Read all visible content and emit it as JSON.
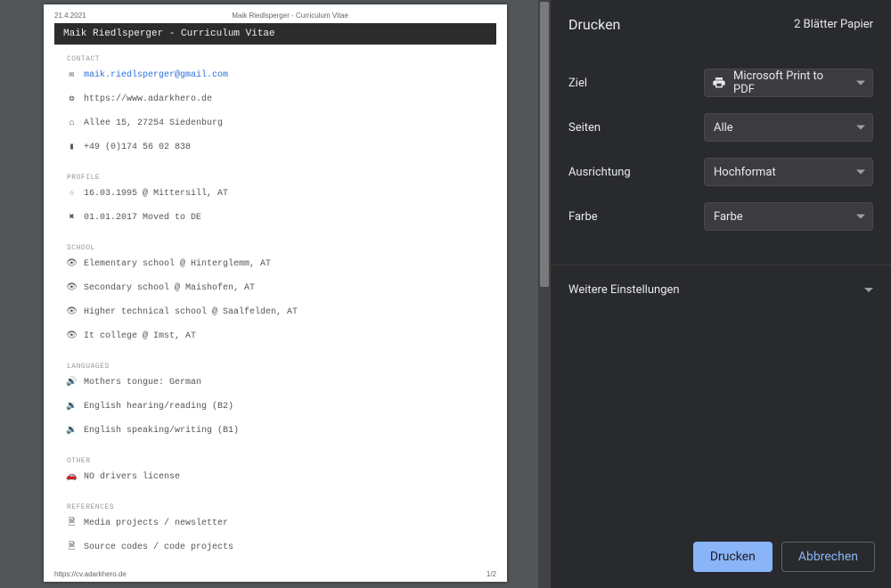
{
  "preview": {
    "date": "21.4.2021",
    "headerTitle": "Maik Riedlsperger - Curriculum Vitae",
    "pageTitle": "Maik Riedlsperger - Curriculum Vitae",
    "footerUrl": "https://cv.adarkhero.de",
    "pageIndicator": "1/2",
    "sections": {
      "contact": {
        "label": "CONTACT",
        "email": "maik.riedlsperger@gmail.com",
        "website": "https://www.adarkhero.de",
        "address": "Allee 15, 27254 Siedenburg",
        "phone": "+49 (0)174 56 02 838"
      },
      "profile": {
        "label": "PROFILE",
        "birth": "16.03.1995 @ Mittersill, AT",
        "moved": "01.01.2017 Moved to DE"
      },
      "school": {
        "label": "SCHOOL",
        "s1": "Elementary school @ Hinterglemm, AT",
        "s2": "Secondary school @ Maishofen, AT",
        "s3": "Higher technical school @ Saalfelden, AT",
        "s4": "It college @ Imst, AT"
      },
      "languages": {
        "label": "LANGUAGES",
        "l1": "Mothers tongue: German",
        "l2": "English hearing/reading (B2)",
        "l3": "English speaking/writing (B1)"
      },
      "other": {
        "label": "OTHER",
        "o1": "NO drivers license"
      },
      "references": {
        "label": "REFERENCES",
        "r1": "Media projects / newsletter",
        "r2": "Source codes / code projects"
      }
    }
  },
  "sidebar": {
    "title": "Drucken",
    "sheetCount": "2 Blätter Papier",
    "labels": {
      "dest": "Ziel",
      "pages": "Seiten",
      "orient": "Ausrichtung",
      "color": "Farbe",
      "more": "Weitere Einstellungen"
    },
    "values": {
      "dest": "Microsoft Print to PDF",
      "pages": "Alle",
      "orient": "Hochformat",
      "color": "Farbe"
    },
    "buttons": {
      "print": "Drucken",
      "cancel": "Abbrechen"
    }
  }
}
